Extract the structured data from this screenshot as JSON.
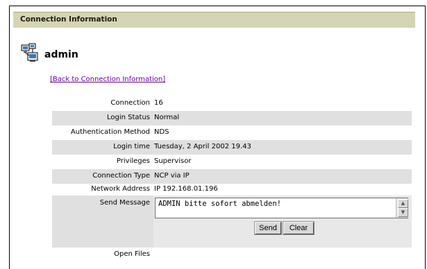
{
  "section": {
    "title": "Connection Information"
  },
  "user": {
    "name": "admin",
    "icon": "network-computers-icon"
  },
  "back_link": "[Back to Connection Information]",
  "rows": [
    {
      "label": "Connection",
      "value": "16"
    },
    {
      "label": "Login Status",
      "value": "Normal"
    },
    {
      "label": "Authentication Method",
      "value": "NDS"
    },
    {
      "label": "Login time",
      "value": "Tuesday, 2 April 2002 19.43"
    },
    {
      "label": "Privileges",
      "value": "Supervisor"
    },
    {
      "label": "Connection Type",
      "value": "NCP via IP"
    },
    {
      "label": "Network Address",
      "value": "IP 192.168.01.196"
    }
  ],
  "send_message": {
    "label": "Send Message",
    "text": "ADMIN bitte sofort abmelden!",
    "send_label": "Send",
    "clear_label": "Clear"
  },
  "open_files": {
    "label": "Open Files"
  },
  "colors": {
    "title_bar": "#d5d5b5",
    "row_shade": "#e0e0e0",
    "link": "#660099"
  }
}
